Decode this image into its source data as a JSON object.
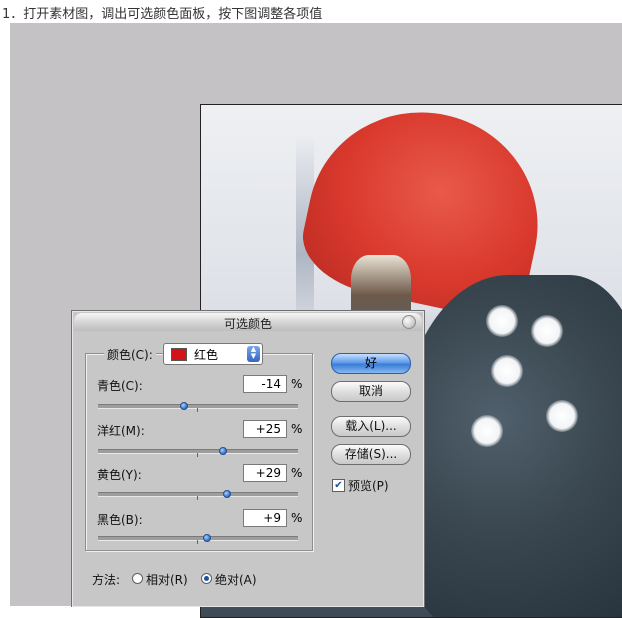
{
  "instruction": "1．打开素材图，调出可选颜色面板，按下图调整各项值",
  "dialog": {
    "title": "可选颜色",
    "color_label": "颜色(C):",
    "color_value": "红色",
    "sliders": [
      {
        "label": "青色(C):",
        "value": "-14",
        "unit": "%",
        "level": -14
      },
      {
        "label": "洋红(M):",
        "value": "+25",
        "unit": "%",
        "level": 25
      },
      {
        "label": "黄色(Y):",
        "value": "+29",
        "unit": "%",
        "level": 29
      },
      {
        "label": "黑色(B):",
        "value": "+9",
        "unit": "%",
        "level": 9
      }
    ],
    "buttons": {
      "ok": "好",
      "cancel": "取消",
      "load": "载入(L)...",
      "save": "存储(S)..."
    },
    "preview_label": "预览(P)",
    "preview_checked": true,
    "method_label": "方法:",
    "relative_label": "相对(R)",
    "absolute_label": "绝对(A)",
    "method_selected": "absolute"
  }
}
